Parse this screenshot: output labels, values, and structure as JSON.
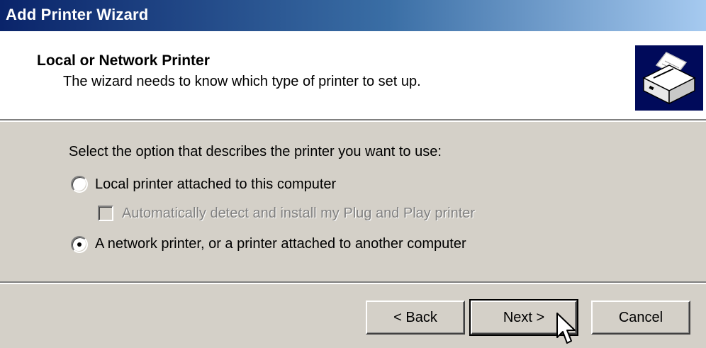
{
  "window": {
    "title": "Add Printer Wizard"
  },
  "header": {
    "title": "Local or Network Printer",
    "subtitle": "The wizard needs to know which type of printer to set up.",
    "icon": "printer-icon"
  },
  "body": {
    "prompt": "Select the option that describes the printer you want to use:",
    "options": [
      {
        "label": "Local printer attached to this computer",
        "selected": false
      },
      {
        "label": "A network printer, or a printer attached to another computer",
        "selected": true
      }
    ],
    "checkbox": {
      "label": "Automatically detect and install my Plug and Play printer",
      "checked": false,
      "enabled": false
    }
  },
  "footer": {
    "back_label": "< Back",
    "next_label": "Next >",
    "cancel_label": "Cancel"
  },
  "colors": {
    "title_gradient_start": "#0a246a",
    "title_gradient_end": "#a6caf0",
    "dialog_face": "#d4d0c8",
    "icon_background": "#000a5a"
  }
}
